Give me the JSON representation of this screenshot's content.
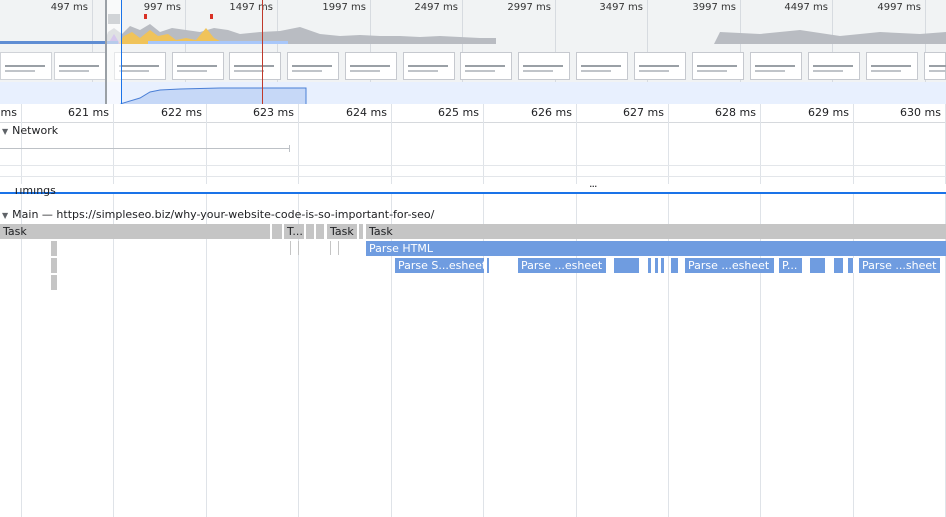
{
  "overview": {
    "tick_labels": [
      "497 ms",
      "997 ms",
      "1497 ms",
      "1997 ms",
      "2497 ms",
      "2997 ms",
      "3497 ms",
      "3997 ms",
      "4497 ms",
      "4997 ms"
    ]
  },
  "ruler": {
    "tick_labels": [
      "ms",
      "621 ms",
      "622 ms",
      "623 ms",
      "624 ms",
      "625 ms",
      "626 ms",
      "627 ms",
      "628 ms",
      "629 ms",
      "630 ms"
    ]
  },
  "tracks": {
    "network_label": "Network",
    "timings_label": "Timings",
    "main_label": "Main — https://simpleseo.biz/why-your-website-code-is-so-important-for-seo/",
    "resize_handle": "..."
  },
  "flame": {
    "task_full": "Task",
    "task_short": "T...",
    "task2": "Task",
    "task3": "Task",
    "parse_html": "Parse HTML",
    "parse_css_1": "Parse S...esheet",
    "parse_css_2": "Parse ...esheet",
    "parse_css_3": "Parse ...esheet",
    "parse_css_4": "P...",
    "parse_css_5": "Parse ...sheet"
  },
  "colors": {
    "task": "#c5c5c5",
    "parse": "#6f9ce0",
    "selection": "#1a73e8",
    "playhead": "#c0392b"
  }
}
